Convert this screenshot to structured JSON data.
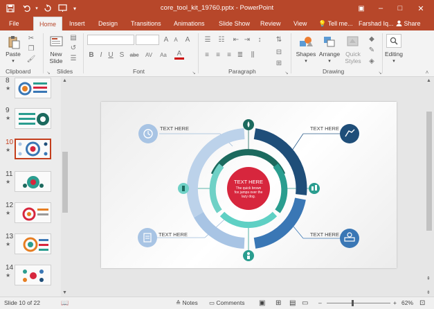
{
  "window": {
    "title": "core_tool_kit_19760.pptx - PowerPoint",
    "undo_icon": "undo-icon",
    "redo_icon": "redo-icon",
    "save_icon": "save-icon",
    "minimize": "–",
    "restore": "□",
    "close": "✕",
    "ribbon_display": "▣"
  },
  "tabs": [
    "File",
    "Home",
    "Insert",
    "Design",
    "Transitions",
    "Animations",
    "Slide Show",
    "Review",
    "View"
  ],
  "tell_me": "Tell me...",
  "user": "Farshad Iq...",
  "share": "Share",
  "ribbon": {
    "clipboard": {
      "label": "Clipboard",
      "paste": "Paste"
    },
    "slides": {
      "label": "Slides",
      "new_slide_line1": "New",
      "new_slide_line2": "Slide"
    },
    "font": {
      "label": "Font",
      "bold": "B",
      "italic": "I",
      "underline": "U",
      "strike": "S",
      "shadow": "abc",
      "spacing": "AV",
      "case": "Aa",
      "grow": "A",
      "shrink": "A",
      "clear": "A",
      "color": "A"
    },
    "paragraph": {
      "label": "Paragraph"
    },
    "drawing": {
      "label": "Drawing",
      "shapes": "Shapes",
      "arrange": "Arrange",
      "quick_styles_line1": "Quick",
      "quick_styles_line2": "Styles"
    },
    "editing": {
      "label": "Editing"
    }
  },
  "thumbnails": [
    {
      "num": "8",
      "star": "★"
    },
    {
      "num": "9",
      "star": "★"
    },
    {
      "num": "10",
      "star": "★"
    },
    {
      "num": "11",
      "star": "★"
    },
    {
      "num": "12",
      "star": "★"
    },
    {
      "num": "13",
      "star": "★"
    },
    {
      "num": "14",
      "star": "★"
    }
  ],
  "slide": {
    "center_title": "TEXT HERE",
    "center_line1": "The quick brown",
    "center_line2": "fox jumps over the",
    "center_line3": "lazy dog.",
    "tl": "TEXT HERE",
    "tr": "TEXT HERE",
    "bl": "TEXT HERE",
    "br": "TEXT HERE",
    "colors": {
      "dark_blue": "#1f4e79",
      "blue": "#3a77b5",
      "light_blue": "#a8c4e4",
      "dark_teal": "#1c6a5e",
      "teal": "#2a9d8f",
      "light_teal": "#6fd1c6",
      "red": "#d7263d"
    }
  },
  "status": {
    "slide_of": "Slide 10 of 22",
    "notes": "Notes",
    "comments": "Comments",
    "zoom": "62%",
    "minus": "–",
    "plus": "+"
  }
}
